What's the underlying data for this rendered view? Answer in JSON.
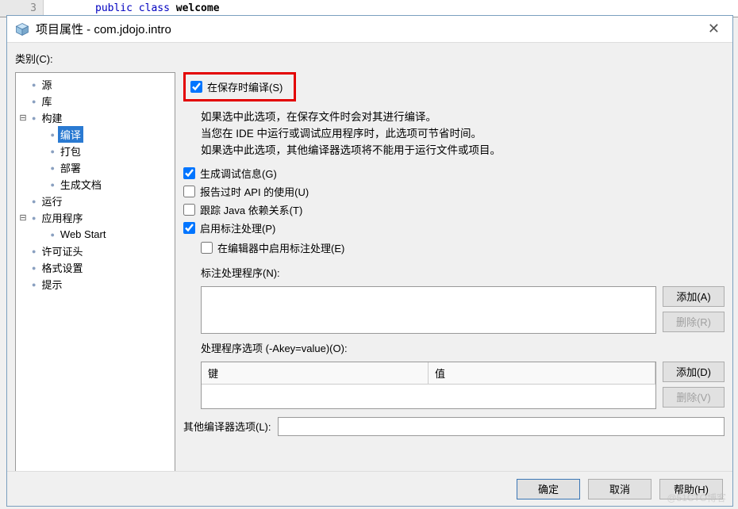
{
  "code_line": {
    "num": "3",
    "kw1": "public class ",
    "kw2": "welcome"
  },
  "titlebar": {
    "title": "项目属性 - com.jdojo.intro"
  },
  "sidebar": {
    "label": "类别(C):",
    "items": [
      {
        "label": "源",
        "depth": 1,
        "twisty": ""
      },
      {
        "label": "库",
        "depth": 1,
        "twisty": ""
      },
      {
        "label": "构建",
        "depth": 1,
        "twisty": "⊟",
        "expandable": true
      },
      {
        "label": "编译",
        "depth": 2,
        "twisty": "",
        "selected": true
      },
      {
        "label": "打包",
        "depth": 2,
        "twisty": ""
      },
      {
        "label": "部署",
        "depth": 2,
        "twisty": ""
      },
      {
        "label": "生成文档",
        "depth": 2,
        "twisty": ""
      },
      {
        "label": "运行",
        "depth": 1,
        "twisty": ""
      },
      {
        "label": "应用程序",
        "depth": 1,
        "twisty": "⊟",
        "expandable": true
      },
      {
        "label": "Web Start",
        "depth": 2,
        "twisty": ""
      },
      {
        "label": "许可证头",
        "depth": 1,
        "twisty": ""
      },
      {
        "label": "格式设置",
        "depth": 1,
        "twisty": ""
      },
      {
        "label": "提示",
        "depth": 1,
        "twisty": ""
      }
    ]
  },
  "main": {
    "compile_on_save": {
      "label": "在保存时编译(S)",
      "checked": true
    },
    "desc_lines": [
      "如果选中此选项，在保存文件时会对其进行编译。",
      "当您在 IDE 中运行或调试应用程序时，此选项可节省时间。",
      "如果选中此选项，其他编译器选项将不能用于运行文件或项目。"
    ],
    "gen_debug": {
      "label": "生成调试信息(G)",
      "checked": true
    },
    "report_api": {
      "label": "报告过时 API 的使用(U)",
      "checked": false
    },
    "track_java": {
      "label": "跟踪 Java 依赖关系(T)",
      "checked": false
    },
    "enable_anno": {
      "label": "启用标注处理(P)",
      "checked": true
    },
    "enable_anno_editor": {
      "label": "在编辑器中启用标注处理(E)",
      "checked": false
    },
    "anno_proc_label": "标注处理程序(N):",
    "anno_proc_add": "添加(A)",
    "anno_proc_del": "删除(R)",
    "proc_opt_label": "处理程序选项 (-Akey=value)(O):",
    "kv_key_hdr": "键",
    "kv_val_hdr": "值",
    "proc_opt_add": "添加(D)",
    "proc_opt_del": "删除(V)",
    "other_opts_label": "其他编译器选项(L):",
    "other_opts_value": ""
  },
  "footer": {
    "ok": "确定",
    "cancel": "取消",
    "help": "帮助(H)"
  }
}
